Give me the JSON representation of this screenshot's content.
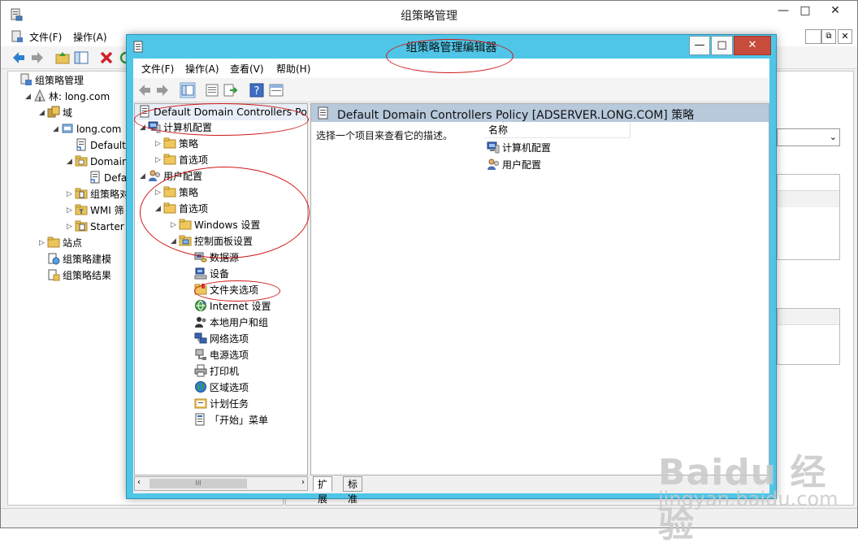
{
  "background_window": {
    "title": "组策略管理",
    "controls": {
      "minimize": "—",
      "maximize": "□",
      "close": "✕"
    },
    "menu": [
      "文件(F)",
      "操作(A)"
    ],
    "tree": [
      {
        "label": "组策略管理",
        "indent": 0,
        "expander": "",
        "icon": "gpm-icon"
      },
      {
        "label": "林: long.com",
        "indent": 1,
        "expander": "◢",
        "icon": "forest-icon"
      },
      {
        "label": "域",
        "indent": 2,
        "expander": "◢",
        "icon": "domains-icon"
      },
      {
        "label": "long.com",
        "indent": 3,
        "expander": "◢",
        "icon": "domain-icon"
      },
      {
        "label": "Default",
        "indent": 4,
        "expander": "",
        "icon": "gpo-link-icon"
      },
      {
        "label": "Domain",
        "indent": 4,
        "expander": "◢",
        "icon": "ou-icon"
      },
      {
        "label": "Defa",
        "indent": 5,
        "expander": "",
        "icon": "gpo-link-icon"
      },
      {
        "label": "组策略对",
        "indent": 4,
        "expander": "▷",
        "icon": "gpo-folder-icon"
      },
      {
        "label": "WMI 筛",
        "indent": 4,
        "expander": "▷",
        "icon": "wmi-folder-icon"
      },
      {
        "label": "Starter",
        "indent": 4,
        "expander": "▷",
        "icon": "starter-folder-icon"
      },
      {
        "label": "站点",
        "indent": 2,
        "expander": "▷",
        "icon": "sites-icon"
      },
      {
        "label": "组策略建模",
        "indent": 2,
        "expander": "",
        "icon": "modeling-icon"
      },
      {
        "label": "组策略结果",
        "indent": 2,
        "expander": "",
        "icon": "results-icon"
      }
    ]
  },
  "editor_window": {
    "title": "组策略管理编辑器",
    "controls": {
      "minimize": "—",
      "maximize": "□",
      "close": "✕"
    },
    "menu": [
      "文件(F)",
      "操作(A)",
      "查看(V)",
      "帮助(H)"
    ],
    "tree_root": "Default Domain Controllers Polic",
    "tree": [
      {
        "label": "计算机配置",
        "indent": 0,
        "expander": "◢",
        "icon": "computer-config-icon"
      },
      {
        "label": "策略",
        "indent": 1,
        "expander": "▷",
        "icon": "folder-icon"
      },
      {
        "label": "首选项",
        "indent": 1,
        "expander": "▷",
        "icon": "folder-icon"
      },
      {
        "label": "用户配置",
        "indent": 0,
        "expander": "◢",
        "icon": "user-config-icon"
      },
      {
        "label": "策略",
        "indent": 1,
        "expander": "▷",
        "icon": "folder-icon"
      },
      {
        "label": "首选项",
        "indent": 1,
        "expander": "◢",
        "icon": "folder-icon"
      },
      {
        "label": "Windows 设置",
        "indent": 2,
        "expander": "▷",
        "icon": "folder-icon"
      },
      {
        "label": "控制面板设置",
        "indent": 2,
        "expander": "◢",
        "icon": "control-panel-folder-icon"
      },
      {
        "label": "数据源",
        "indent": 3,
        "expander": "",
        "icon": "data-source-icon"
      },
      {
        "label": "设备",
        "indent": 3,
        "expander": "",
        "icon": "device-icon"
      },
      {
        "label": "文件夹选项",
        "indent": 3,
        "expander": "",
        "icon": "folder-options-icon"
      },
      {
        "label": "Internet 设置",
        "indent": 3,
        "expander": "",
        "icon": "internet-icon"
      },
      {
        "label": "本地用户和组",
        "indent": 3,
        "expander": "",
        "icon": "local-users-icon"
      },
      {
        "label": "网络选项",
        "indent": 3,
        "expander": "",
        "icon": "network-icon"
      },
      {
        "label": "电源选项",
        "indent": 3,
        "expander": "",
        "icon": "power-icon"
      },
      {
        "label": "打印机",
        "indent": 3,
        "expander": "",
        "icon": "printer-icon"
      },
      {
        "label": "区域选项",
        "indent": 3,
        "expander": "",
        "icon": "regional-icon"
      },
      {
        "label": "计划任务",
        "indent": 3,
        "expander": "",
        "icon": "scheduled-task-icon"
      },
      {
        "label": "「开始」菜单",
        "indent": 3,
        "expander": "",
        "icon": "start-menu-icon"
      }
    ],
    "right_header": "Default Domain Controllers Policy [ADSERVER.LONG.COM] 策略",
    "description": "选择一个项目来查看它的描述。",
    "column_name": "名称",
    "items": [
      {
        "label": "计算机配置",
        "icon": "computer-config-icon"
      },
      {
        "label": "用户配置",
        "icon": "user-config-icon"
      }
    ],
    "tabs": [
      "扩展",
      "标准"
    ],
    "scroll_thumb": "III"
  },
  "watermark": {
    "brand": "Baidu 经验",
    "url": "jingyan.baidu.com"
  }
}
